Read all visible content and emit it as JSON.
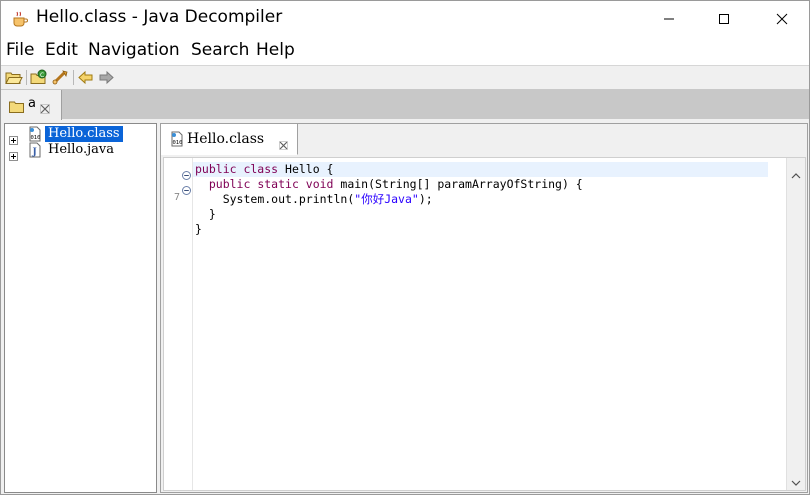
{
  "window": {
    "title": "Hello.class - Java Decompiler",
    "minimize_icon": "minimize-icon",
    "maximize_icon": "maximize-icon",
    "close_icon": "close-icon"
  },
  "menu": {
    "items": [
      "File",
      "Edit",
      "Navigation",
      "Search",
      "Help"
    ]
  },
  "toolbar": {
    "buttons": [
      "open-file-icon",
      "open-type-icon",
      "open-type-hierarchy-icon",
      "back-arrow-icon",
      "forward-arrow-icon"
    ]
  },
  "outer_tab": {
    "label": "a"
  },
  "tree": {
    "items": [
      {
        "label": "Hello.class",
        "icon": "class-file-icon",
        "selected": true
      },
      {
        "label": "Hello.java",
        "icon": "java-file-icon",
        "selected": false
      }
    ]
  },
  "editor": {
    "tab_label": "Hello.class",
    "line_number": "7",
    "code": {
      "l1_kw": "public class",
      "l1_rest": " Hello {",
      "l2_kw": "public static void",
      "l2_rest": " main(String[] paramArrayOfString) {",
      "l3_pre": "System.out.println(",
      "l3_str": "\"你好Java\"",
      "l3_post": ");",
      "l4": "}",
      "l5": "}"
    }
  },
  "colors": {
    "selection": "#0a64d8",
    "keyword": "#7f0055",
    "string": "#2a00ff",
    "current_line": "#e8f2fe"
  }
}
